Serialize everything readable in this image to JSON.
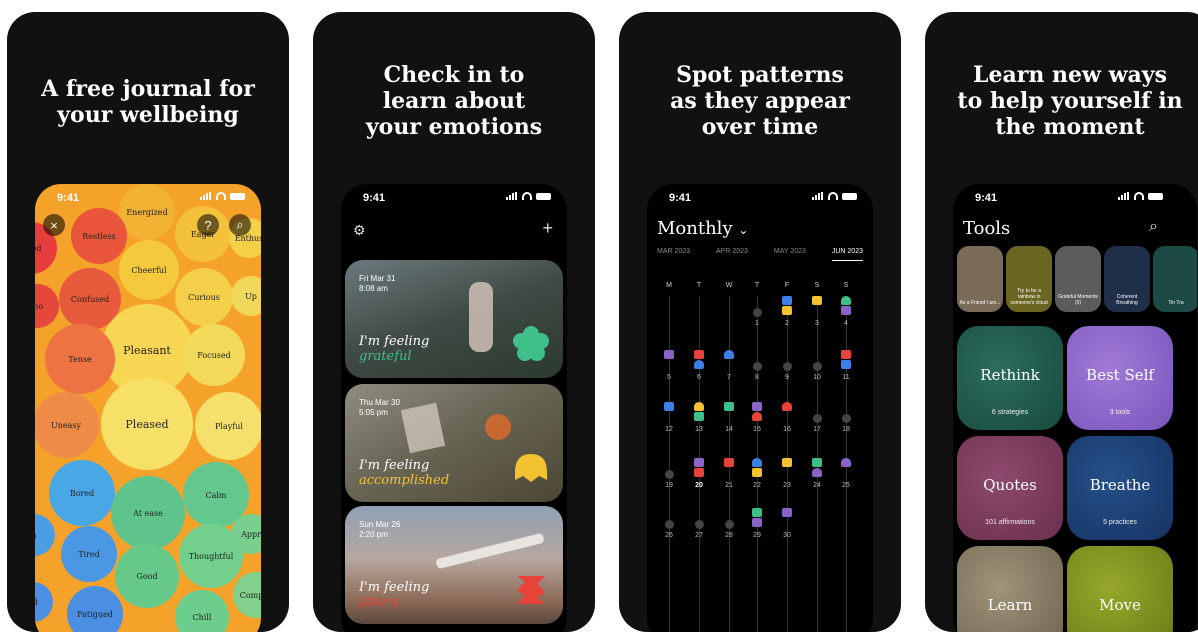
{
  "panels": [
    {
      "headline": [
        "A free journal for",
        "your wellbeing"
      ]
    },
    {
      "headline": [
        "Check in to",
        "learn about",
        "your emotions"
      ]
    },
    {
      "headline": [
        "Spot patterns",
        "as they appear",
        "over time"
      ]
    },
    {
      "headline": [
        "Learn new ways",
        "to help yourself in",
        "the moment"
      ]
    }
  ],
  "status": {
    "time": "9:41"
  },
  "emotions": {
    "close": "×",
    "help": "?",
    "search": "⌕",
    "bubbles": [
      "Energized",
      "Restless",
      "Eager",
      "Enthus",
      "tated",
      "Cheerful",
      "Confused",
      "Curious",
      "Up",
      "mo",
      "Pleasant",
      "Tense",
      "Focused",
      "Uneasy",
      "Pleased",
      "Playful",
      "Bored",
      "At ease",
      "Calm",
      "Appr",
      "h",
      "Tired",
      "Thoughtful",
      "Good",
      "ad",
      "Compas",
      "Fatigued",
      "Chill"
    ]
  },
  "journal": {
    "settings": "⚙",
    "add": "+",
    "entries": [
      {
        "date": "Fri Mar 31",
        "time": "8:08 am",
        "prefix": "I'm feeling",
        "emotion": "grateful",
        "color": "#3fbf8a"
      },
      {
        "date": "Thu Mar 30",
        "time": "5:05 pm",
        "prefix": "I'm feeling",
        "emotion": "accomplished",
        "color": "#f2c230"
      },
      {
        "date": "Sun Mar 26",
        "time": "2:20 pm",
        "prefix": "I'm feeling",
        "emotion": "jittery",
        "color": "#e8433a"
      }
    ]
  },
  "calendar": {
    "title": "Monthly",
    "chevron": "⌄",
    "tabs": [
      "MAR 2023",
      "APR 2023",
      "MAY 2023",
      "JUN 2023"
    ],
    "active_tab": "JUN 2023",
    "weekdays": [
      "M",
      "T",
      "W",
      "T",
      "F",
      "S",
      "S"
    ],
    "days": [
      "1",
      "2",
      "3",
      "4",
      "5",
      "6",
      "7",
      "8",
      "9",
      "10",
      "11",
      "12",
      "13",
      "14",
      "15",
      "16",
      "17",
      "18",
      "19",
      "20",
      "21",
      "22",
      "23",
      "24",
      "25",
      "26",
      "27",
      "28",
      "29",
      "30"
    ],
    "today": "20"
  },
  "tools": {
    "title": "Tools",
    "search": "⌕",
    "thumbs": [
      {
        "label": "As a Friend I am...",
        "color": "#7a6a58"
      },
      {
        "label": "Try to be a rainbow in someone's cloud",
        "color": "#6b6522"
      },
      {
        "label": "Grateful Moments (5)",
        "color": "#5c5c5c"
      },
      {
        "label": "Coherent Breathing",
        "color": "#1f2f4a"
      },
      {
        "label": "Tin Tra",
        "color": "#1d4a44"
      }
    ],
    "tiles": [
      {
        "title": "Rethink",
        "sub": "6 strategies",
        "color": "#1f5a4c"
      },
      {
        "title": "Best Self",
        "sub": "3 tools",
        "color": "#8a63c9"
      },
      {
        "title": "Quotes",
        "sub": "101 affirmations",
        "color": "#7a3a5c"
      },
      {
        "title": "Breathe",
        "sub": "5 practices",
        "color": "#1d3d6e"
      },
      {
        "title": "Learn",
        "sub": "",
        "color": "#8a7e66"
      },
      {
        "title": "Move",
        "sub": "",
        "color": "#7a8a1f"
      }
    ]
  }
}
